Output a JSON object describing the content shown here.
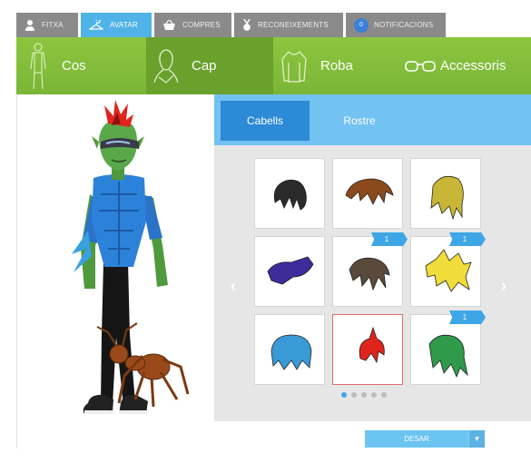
{
  "tabs": [
    {
      "label": "FITXA",
      "icon": "person-icon"
    },
    {
      "label": "AVATAR",
      "icon": "hanger-icon"
    },
    {
      "label": "COMPRES",
      "icon": "basket-icon"
    },
    {
      "label": "RECONEIXEMENTS",
      "icon": "medal-icon"
    },
    {
      "label": "NOTIFICACIONS",
      "icon": "notification-badge",
      "badge": "0"
    }
  ],
  "categories": [
    {
      "label": "Cos",
      "icon": "body-icon"
    },
    {
      "label": "Cap",
      "icon": "head-icon"
    },
    {
      "label": "Roba",
      "icon": "shirt-icon"
    },
    {
      "label": "Accessoris",
      "icon": "glasses-icon"
    }
  ],
  "subtabs": [
    {
      "label": "Cabells"
    },
    {
      "label": "Rostre"
    }
  ],
  "items": [
    {
      "name": "hair-black-spiky",
      "color": "#2a2a2a"
    },
    {
      "name": "hair-brown-swept",
      "color": "#8a4a1c"
    },
    {
      "name": "hair-blonde-long",
      "color": "#c9b636"
    },
    {
      "name": "hair-purple-wave",
      "color": "#3d2c9a"
    },
    {
      "name": "hair-brown-messy",
      "color": "#5a4a3c",
      "tag": "1"
    },
    {
      "name": "hair-yellow-spiky",
      "color": "#f0dc3a",
      "tag": "1"
    },
    {
      "name": "hair-blue-curly",
      "color": "#3a9ad6"
    },
    {
      "name": "hair-red-mohawk",
      "color": "#e0241c",
      "selected": true
    },
    {
      "name": "hair-green-long",
      "color": "#2e9a4a",
      "tag": "1"
    }
  ],
  "pagination": {
    "pages": 5,
    "current": 1
  },
  "save_label": "DESAR",
  "colors": {
    "accent_green": "#8cc63f",
    "accent_blue": "#72c2f2",
    "active_blue": "#2c8ad6"
  }
}
